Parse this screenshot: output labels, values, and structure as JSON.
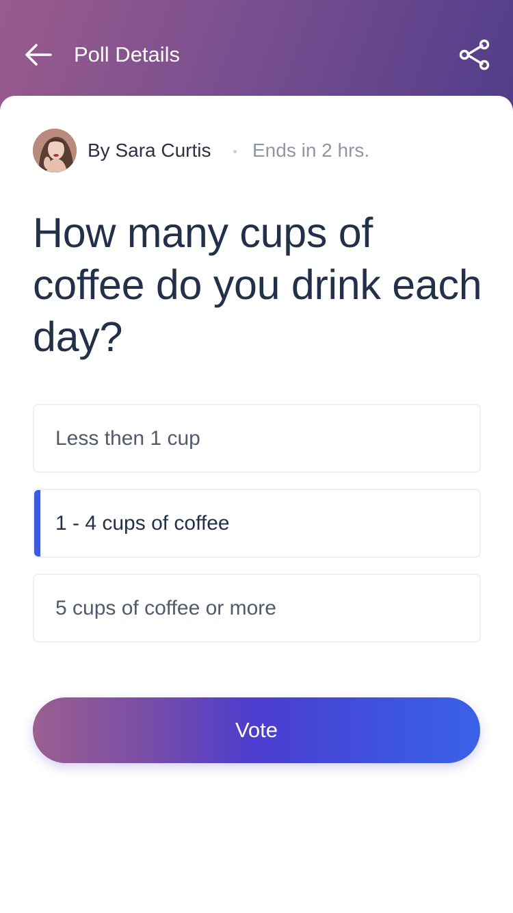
{
  "header": {
    "title": "Poll Details",
    "back_icon": "arrow-left-icon",
    "share_icon": "share-icon",
    "gradient_colors": [
      "#9a5b8e",
      "#7a4f8f",
      "#503c8a"
    ]
  },
  "poll": {
    "author": "By Sara Curtis",
    "ends": "Ends in 2 hrs.",
    "question": "How many cups of coffee do you drink each day?",
    "options": [
      {
        "label": "Less then 1 cup",
        "selected": false
      },
      {
        "label": "1 - 4 cups of coffee",
        "selected": true
      },
      {
        "label": "5 cups of coffee or more",
        "selected": false
      }
    ],
    "selected_accent": "#3b5bdb"
  },
  "actions": {
    "vote_label": "Vote"
  }
}
